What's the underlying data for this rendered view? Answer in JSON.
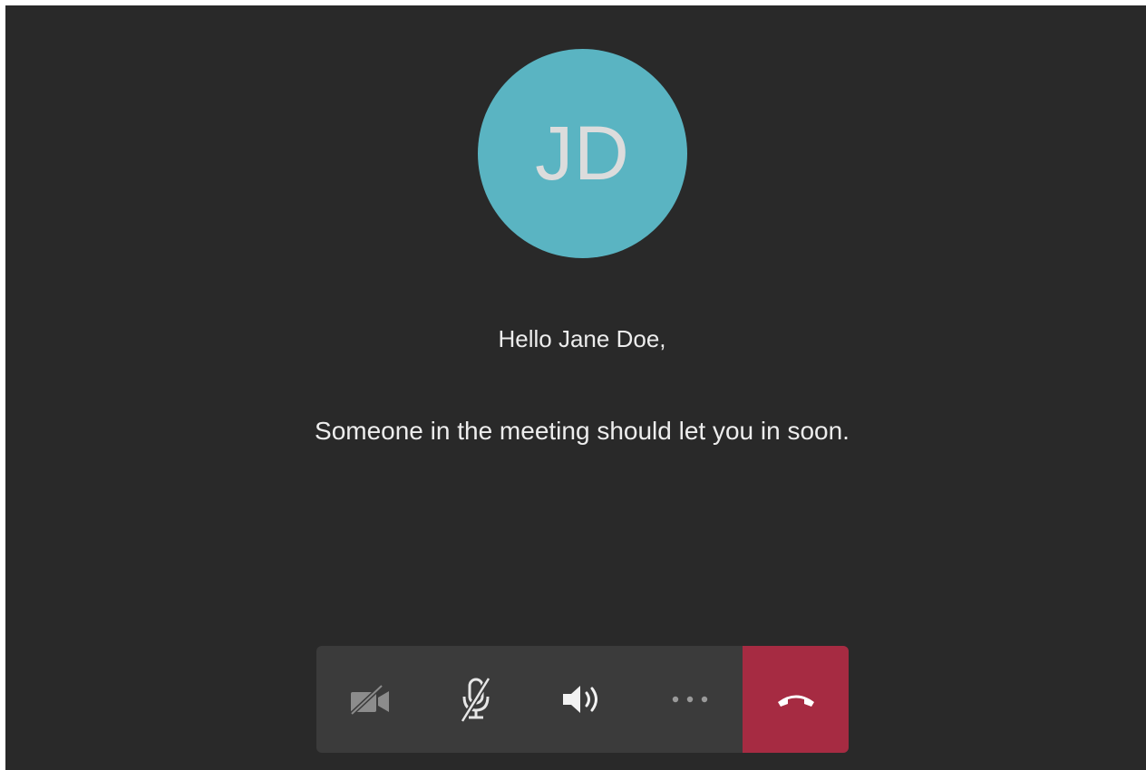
{
  "participant": {
    "initials": "JD"
  },
  "lobby": {
    "greeting": "Hello Jane Doe,",
    "message": "Someone in the meeting should let you in soon."
  },
  "toolbar": {
    "buttons": [
      {
        "icon": "camera-off-icon"
      },
      {
        "icon": "microphone-muted-icon"
      },
      {
        "icon": "speaker-icon"
      },
      {
        "icon": "more-options-icon"
      },
      {
        "icon": "hang-up-icon"
      }
    ]
  },
  "colors": {
    "background": "#292929",
    "avatar": "#5ab4c2",
    "toolbar": "#3b3b3b",
    "hangup": "#a62b42"
  }
}
